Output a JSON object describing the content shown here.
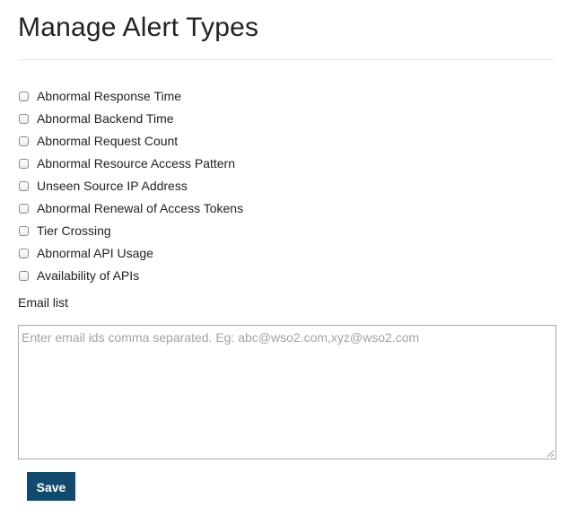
{
  "page": {
    "title": "Manage Alert Types"
  },
  "alert_types": [
    {
      "label": "Abnormal Response Time",
      "checked": false
    },
    {
      "label": "Abnormal Backend Time",
      "checked": false
    },
    {
      "label": "Abnormal Request Count",
      "checked": false
    },
    {
      "label": "Abnormal Resource Access Pattern",
      "checked": false
    },
    {
      "label": "Unseen Source IP Address",
      "checked": false
    },
    {
      "label": "Abnormal Renewal of Access Tokens",
      "checked": false
    },
    {
      "label": "Tier Crossing",
      "checked": false
    },
    {
      "label": "Abnormal API Usage",
      "checked": false
    },
    {
      "label": "Availability of APIs",
      "checked": false
    }
  ],
  "email": {
    "label": "Email list",
    "value": "",
    "placeholder": "Enter email ids comma separated. Eg: abc@wso2.com,xyz@wso2.com"
  },
  "actions": {
    "save_label": "Save"
  },
  "colors": {
    "button_bg": "#124a6e",
    "button_text": "#ffffff",
    "placeholder_text": "#a3a3a3"
  }
}
